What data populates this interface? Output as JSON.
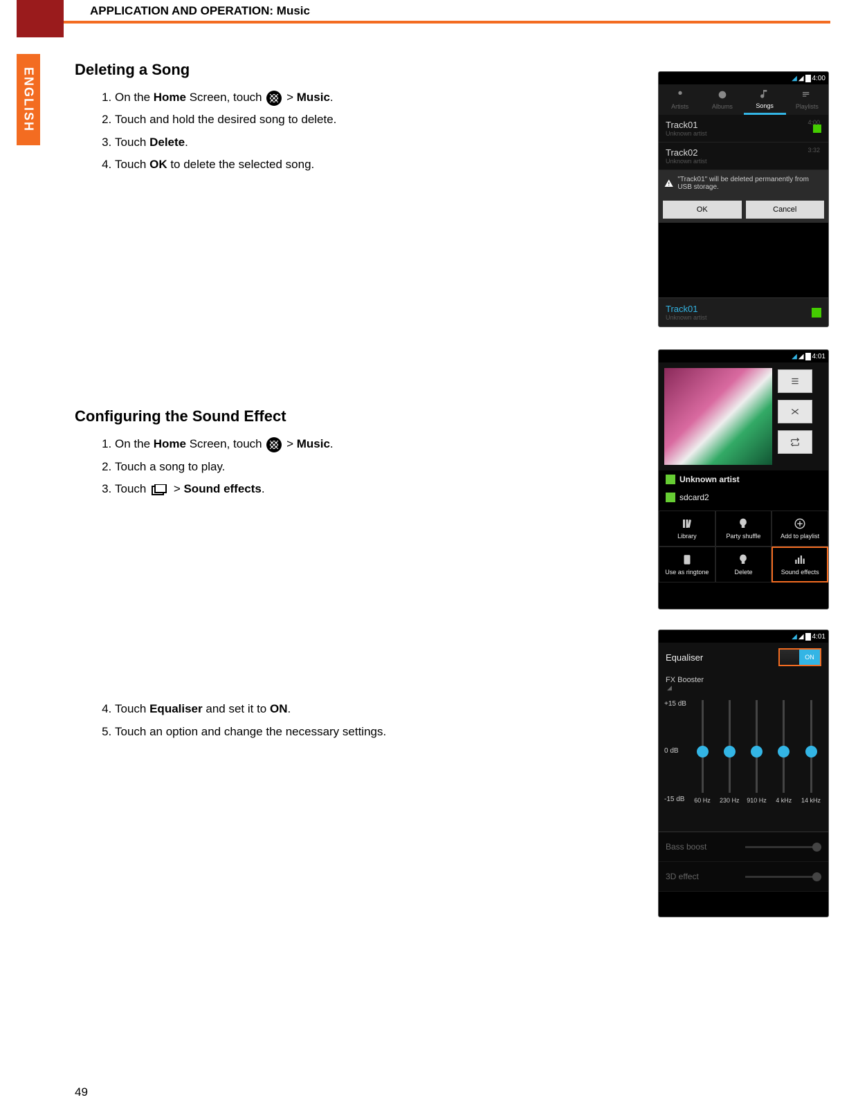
{
  "header": {
    "title": "APPLICATION AND OPERATION: Music"
  },
  "side_tab": "ENGLISH",
  "page_number": "49",
  "section1": {
    "heading": "Deleting a Song",
    "steps": {
      "s1a": "On the ",
      "s1b": "Home",
      "s1c": " Screen, touch ",
      "s1d": " > ",
      "s1e": "Music",
      "s1f": ".",
      "s2": "Touch and hold the desired song to delete.",
      "s3a": "Touch ",
      "s3b": "Delete",
      "s3c": ".",
      "s4a": "Touch ",
      "s4b": "OK",
      "s4c": " to delete the selected song."
    }
  },
  "section2": {
    "heading": "Configuring the Sound Effect",
    "steps": {
      "s1a": "On the ",
      "s1b": "Home",
      "s1c": " Screen, touch ",
      "s1d": " > ",
      "s1e": "Music",
      "s1f": ".",
      "s2": "Touch a song to play.",
      "s3a": "Touch ",
      "s3b": " > ",
      "s3c": "Sound effects",
      "s3d": ".",
      "s4a": "Touch ",
      "s4b": "Equaliser",
      "s4c": " and set it to ",
      "s4d": "ON",
      "s4e": ".",
      "s5": "Touch an option and change the necessary settings."
    }
  },
  "phone1": {
    "time": "4:00",
    "tabs": [
      "Artists",
      "Albums",
      "Songs",
      "Playlists"
    ],
    "tracks": [
      {
        "title": "Track01",
        "artist": "Unknown artist",
        "dur": "4:00"
      },
      {
        "title": "Track02",
        "artist": "Unknown artist",
        "dur": "3:32"
      }
    ],
    "dialog_msg": "\"Track01\" will be deleted permanently from USB storage.",
    "ok": "OK",
    "cancel": "Cancel",
    "now_title": "Track01",
    "now_artist": "Unknown artist"
  },
  "phone2": {
    "time": "4:01",
    "artist_label": "Unknown artist",
    "source_label": "sdcard2",
    "menu": [
      "Library",
      "Party shuffle",
      "Add to playlist",
      "Use as ringtone",
      "Delete",
      "Sound effects"
    ]
  },
  "phone3": {
    "time": "4:01",
    "eq_label": "Equaliser",
    "toggle": "ON",
    "fx_label": "FX Booster",
    "db_labels": [
      "+15 dB",
      "0 dB",
      "-15 dB"
    ],
    "freqs": [
      "60 Hz",
      "230 Hz",
      "910 Hz",
      "4 kHz",
      "14 kHz"
    ],
    "bass": "Bass boost",
    "threeD": "3D effect"
  }
}
